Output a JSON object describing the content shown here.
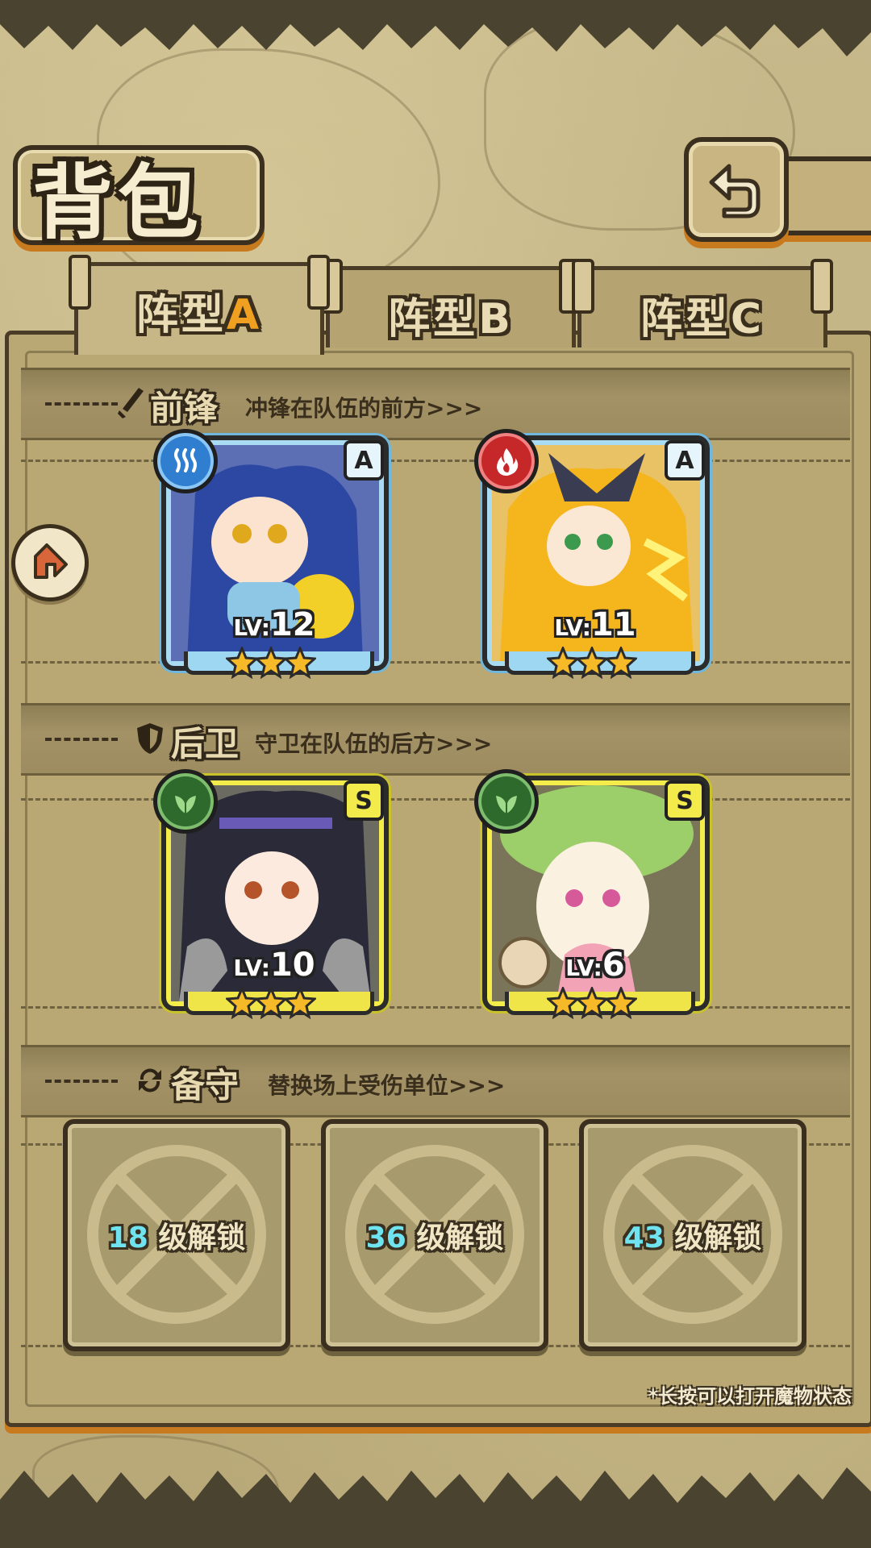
{
  "header": {
    "title": "背包",
    "back_icon": "return-arrow-icon"
  },
  "tabs": [
    {
      "label": "阵型",
      "letter": "A",
      "active": true
    },
    {
      "label": "阵型",
      "letter": "B",
      "active": false
    },
    {
      "label": "阵型",
      "letter": "C",
      "active": false
    }
  ],
  "sections": {
    "front": {
      "icon": "sword-icon",
      "title": "前锋",
      "subtitle": "冲锋在队伍的前方>>>"
    },
    "back": {
      "icon": "shield-icon",
      "title": "后卫",
      "subtitle": "守卫在队伍的后方>>>"
    },
    "reserve": {
      "icon": "refresh-icon",
      "title": "备守",
      "subtitle": "替换场上受伤单位>>>"
    }
  },
  "front_units": [
    {
      "element": "water-icon",
      "rank": "A",
      "level_prefix": "LV:",
      "level": "12",
      "stars": 3
    },
    {
      "element": "fire-icon",
      "rank": "A",
      "level_prefix": "LV:",
      "level": "11",
      "stars": 3
    }
  ],
  "back_units": [
    {
      "element": "leaf-icon",
      "rank": "S",
      "level_prefix": "LV:",
      "level": "10",
      "stars": 3
    },
    {
      "element": "leaf-icon",
      "rank": "S",
      "level_prefix": "LV:",
      "level": "6",
      "stars": 3
    }
  ],
  "reserve_slots": [
    {
      "level": "18",
      "suffix": " 级解锁"
    },
    {
      "level": "36",
      "suffix": " 级解锁"
    },
    {
      "level": "43",
      "suffix": " 级解锁"
    }
  ],
  "hint": "*长按可以打开魔物状态",
  "colors": {
    "accent_orange": "#c87a1e",
    "tab_letter": "#f0a020",
    "unlock_number": "#6fe4f0"
  }
}
